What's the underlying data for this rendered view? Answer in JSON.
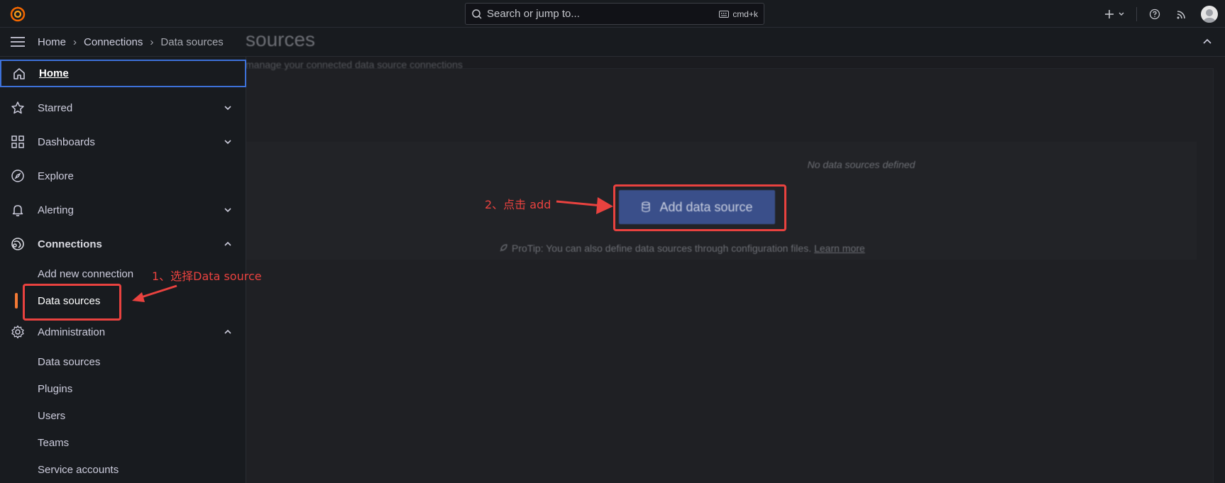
{
  "topbar": {
    "search_placeholder": "Search or jump to...",
    "shortcut": "cmd+k"
  },
  "breadcrumb": {
    "items": [
      "Home",
      "Connections",
      "Data sources"
    ]
  },
  "sidebar": {
    "items": [
      {
        "label": "Home",
        "icon": "home-icon"
      },
      {
        "label": "Starred",
        "icon": "star-icon"
      },
      {
        "label": "Dashboards",
        "icon": "dashboards-icon"
      },
      {
        "label": "Explore",
        "icon": "compass-icon"
      },
      {
        "label": "Alerting",
        "icon": "bell-icon"
      },
      {
        "label": "Connections",
        "icon": "connections-icon"
      },
      {
        "label": "Administration",
        "icon": "gear-icon"
      }
    ],
    "connections_sub": [
      "Add new connection",
      "Data sources"
    ],
    "admin_sub": [
      "Data sources",
      "Plugins",
      "Users",
      "Teams",
      "Service accounts"
    ]
  },
  "page": {
    "title": "sources",
    "subtitle": "manage your connected data source connections",
    "empty_text": "No data sources defined",
    "add_button": "Add data source",
    "protip": "ProTip: You can also define data sources through configuration files.",
    "learn_more": "Learn more"
  },
  "annotations": {
    "step1": "1、选择Data source",
    "step2": "2、点击 add",
    "color": "#e9423f"
  },
  "colors": {
    "accent_orange": "#f47a35",
    "focus_blue": "#3d71d9",
    "primary_button": "#3a4f8a"
  }
}
